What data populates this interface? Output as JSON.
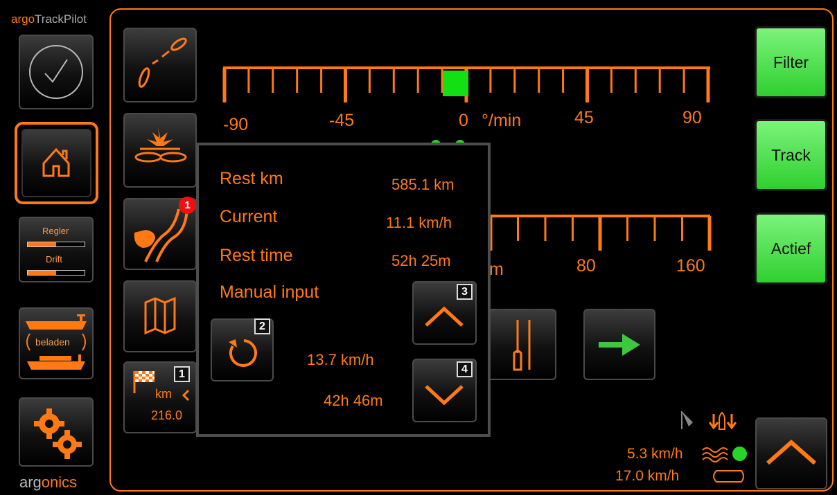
{
  "brand": {
    "prefix": "argo",
    "name": "TrackPilot"
  },
  "footer": {
    "prefix": "arg",
    "name": "onics"
  },
  "sidebar": {
    "regler_label": "Regler",
    "drift_label": "Drift",
    "regler_level": 0.5,
    "drift_level": 0.5,
    "load_label": "beladen"
  },
  "tools": {
    "destination_unit": "km",
    "destination_value": "216.0",
    "destination_badge": "1",
    "notification_count": "1"
  },
  "scale_top": {
    "labels": [
      "-90",
      "-45",
      "0",
      "°/min",
      "45",
      "90"
    ],
    "indicator_value": 0
  },
  "scale_bottom": {
    "labels": [
      "m",
      "80",
      "160"
    ]
  },
  "right_buttons": {
    "filter": "Filter",
    "track": "Track",
    "active": "Actief"
  },
  "popup": {
    "rest_km_label": "Rest km",
    "rest_km_value": "585.1 km",
    "current_label": "Current",
    "current_value": "11.1 km/h",
    "rest_time_label": "Rest time",
    "rest_time_value": "52h 25m",
    "manual_label": "Manual input",
    "manual_speed": "13.7 km/h",
    "manual_time": "42h 46m",
    "badge_reset": "2",
    "badge_up": "3",
    "badge_down": "4"
  },
  "status": {
    "water_speed": "5.3 km/h",
    "ship_speed": "17.0 km/h"
  },
  "colors": {
    "accent": "#ff7a14",
    "green": "#2fcf2f",
    "frame": "#4d4d4d"
  }
}
